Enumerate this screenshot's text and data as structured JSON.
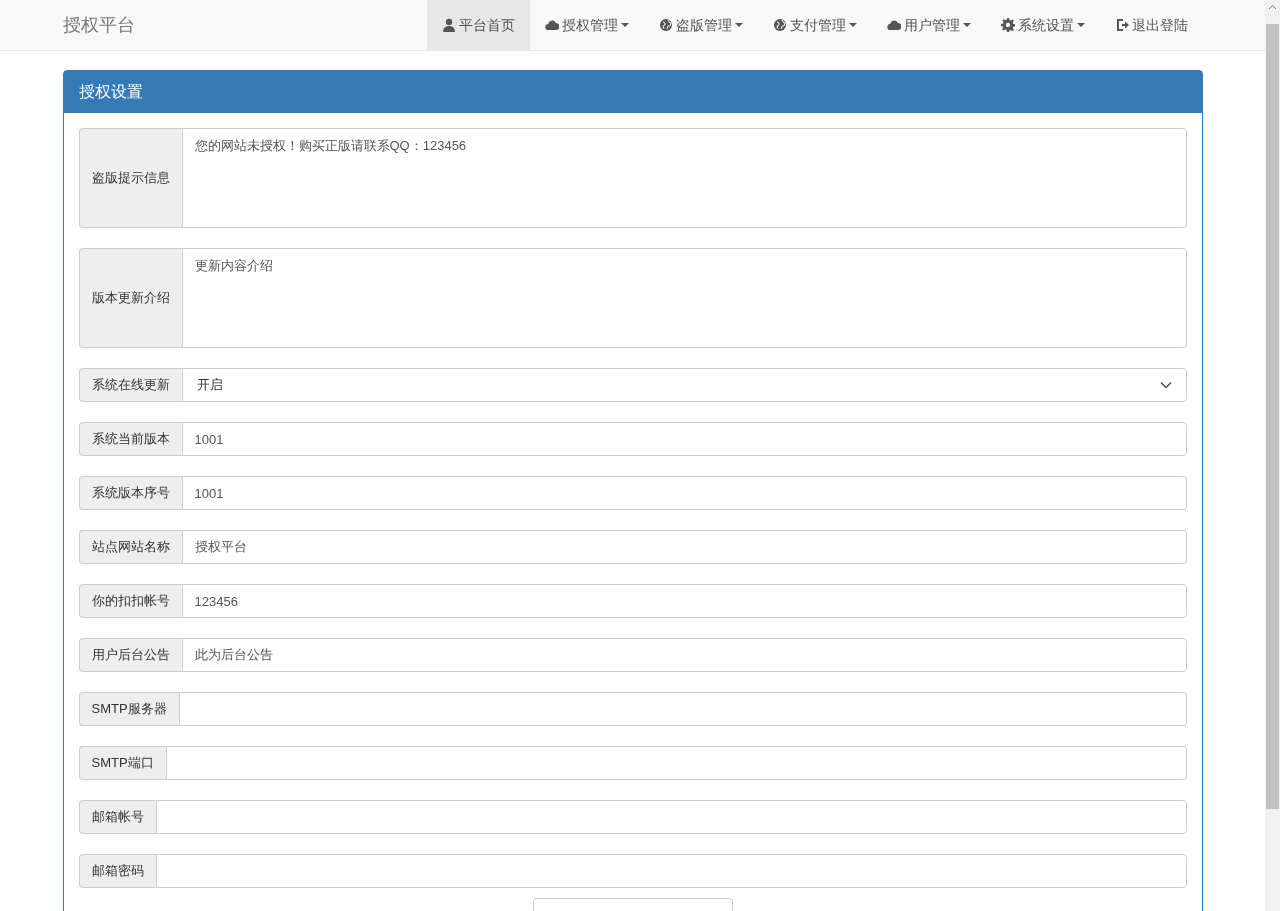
{
  "navbar": {
    "brand": "授权平台",
    "items": [
      {
        "label": "平台首页",
        "dropdown": false,
        "selected": true
      },
      {
        "label": "授权管理",
        "dropdown": true,
        "selected": false
      },
      {
        "label": "盗版管理",
        "dropdown": true,
        "selected": false
      },
      {
        "label": "支付管理",
        "dropdown": true,
        "selected": false
      },
      {
        "label": "用户管理",
        "dropdown": true,
        "selected": false
      },
      {
        "label": "系统设置",
        "dropdown": true,
        "selected": false
      },
      {
        "label": "退出登陆",
        "dropdown": false,
        "selected": false
      }
    ]
  },
  "panel": {
    "title": "授权设置",
    "fields": [
      {
        "kind": "textarea",
        "label": "盗版提示信息",
        "value": "您的网站未授权！购买正版请联系QQ：123456"
      },
      {
        "kind": "textarea",
        "label": "版本更新介绍",
        "value": "更新内容介绍"
      },
      {
        "kind": "select",
        "label": "系统在线更新",
        "value": "开启"
      },
      {
        "kind": "input",
        "label": "系统当前版本",
        "value": "1001"
      },
      {
        "kind": "input",
        "label": "系统版本序号",
        "value": "1001"
      },
      {
        "kind": "input",
        "label": "站点网站名称",
        "value": "授权平台"
      },
      {
        "kind": "input",
        "label": "你的扣扣帐号",
        "value": "123456"
      },
      {
        "kind": "input",
        "label": "用户后台公告",
        "value": "此为后台公告"
      },
      {
        "kind": "input",
        "label": "SMTP服务器"
      },
      {
        "kind": "input",
        "label": "SMTP端口"
      },
      {
        "kind": "input",
        "label": "邮箱帐号"
      },
      {
        "kind": "input",
        "label": "邮箱密码"
      }
    ]
  }
}
